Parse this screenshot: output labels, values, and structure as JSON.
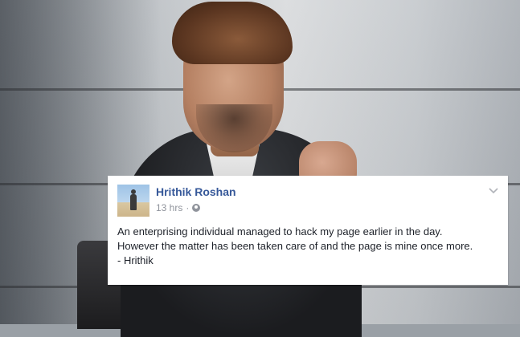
{
  "post": {
    "author": "Hrithik Roshan",
    "timestamp": "13 hrs",
    "separator": "·",
    "privacy_icon": "globe-icon",
    "menu_icon": "chevron-down-icon",
    "text_lines": [
      "An enterprising individual managed to hack my page earlier in the day.",
      "However the matter has been taken care of and the page is mine once more.",
      "- Hrithik"
    ]
  },
  "colors": {
    "author_link": "#365899",
    "meta_text": "#90949c",
    "body_text": "#1d2129",
    "card_bg": "#ffffff"
  }
}
